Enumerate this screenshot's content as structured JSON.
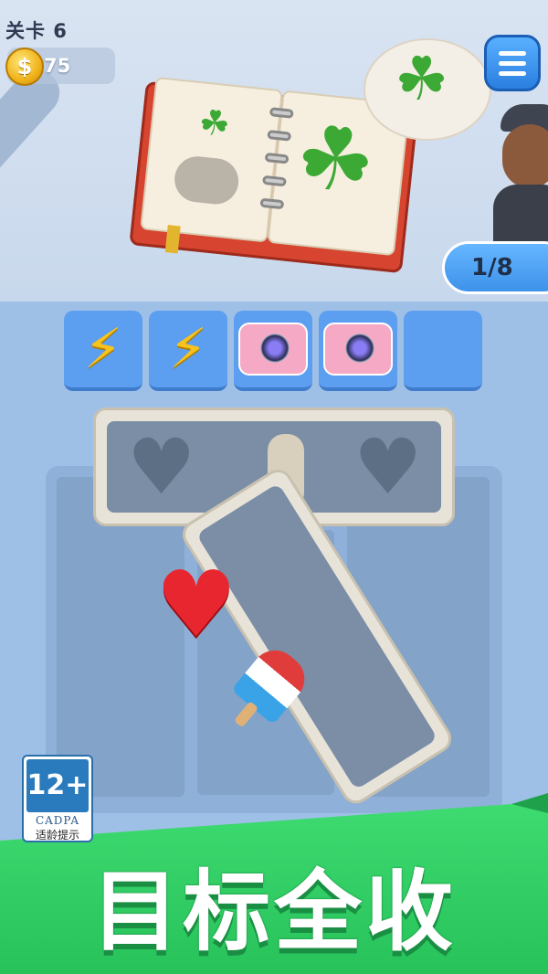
{
  "hud": {
    "level_label": "关卡 6",
    "coin_symbol": "$",
    "coins": "75",
    "progress": "1/8"
  },
  "target_item": "four-leaf-clover-icon",
  "album": {
    "left_page_item": "clover-icon",
    "right_page_item": "clover-icon"
  },
  "tray": {
    "capacity": 5,
    "slots": [
      "lightning-icon",
      "lightning-icon",
      "camera-icon",
      "camera-icon",
      "empty"
    ]
  },
  "tiles": {
    "top_tile_items": [
      "heart-silhouette",
      "popsicle-silhouette",
      "heart-silhouette"
    ],
    "tilted_tile_items": [
      "heart-icon",
      "popsicle-icon",
      "silhouette"
    ]
  },
  "rating": {
    "age": "12+",
    "org": "CADPA",
    "note": "适龄提示"
  },
  "banner": {
    "title": "目标全收"
  },
  "colors": {
    "banner": "#3edb71",
    "accent_blue": "#3d92ea",
    "heart": "#e8262f",
    "clover": "#3da935"
  }
}
